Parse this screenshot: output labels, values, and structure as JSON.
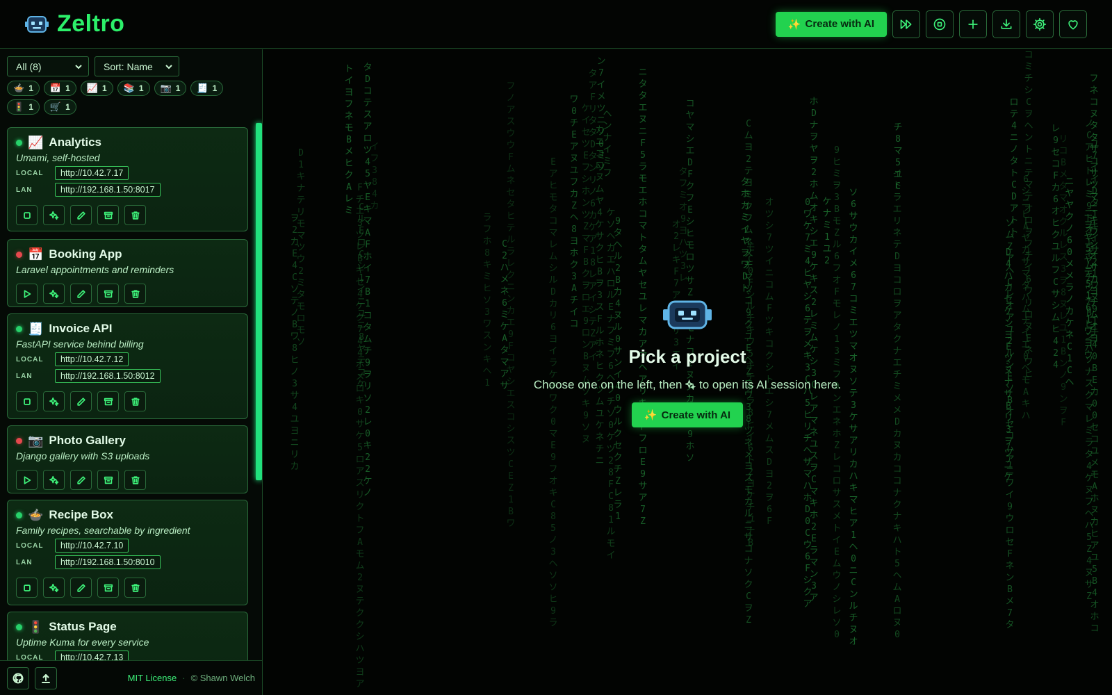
{
  "app": {
    "title": "Zeltro"
  },
  "header": {
    "create_label": "Create with AI",
    "create_spark": "✨",
    "icons": [
      "fast-forward-icon",
      "stop-circle-icon",
      "plus-icon",
      "download-icon",
      "gear-icon",
      "heart-icon"
    ]
  },
  "filters": {
    "category": "All (8)",
    "sort": "Sort: Name"
  },
  "chips": [
    {
      "emoji": "🍲",
      "count": "1"
    },
    {
      "emoji": "📅",
      "count": "1"
    },
    {
      "emoji": "📈",
      "count": "1"
    },
    {
      "emoji": "📚",
      "count": "1"
    },
    {
      "emoji": "📷",
      "count": "1"
    },
    {
      "emoji": "🧾",
      "count": "1"
    },
    {
      "emoji": "🚦",
      "count": "1"
    },
    {
      "emoji": "🛒",
      "count": "1"
    }
  ],
  "url_labels": {
    "local": "LOCAL",
    "lan": "LAN"
  },
  "projects": [
    {
      "name": "Analytics",
      "emoji": "📈",
      "status": "running",
      "desc": "Umami, self-hosted",
      "local": "http://10.42.7.17",
      "lan": "http://192.168.1.50:8017"
    },
    {
      "name": "Booking App",
      "emoji": "📅",
      "status": "stopped",
      "desc": "Laravel appointments and reminders",
      "local": "",
      "lan": ""
    },
    {
      "name": "Invoice API",
      "emoji": "🧾",
      "status": "running",
      "desc": "FastAPI service behind billing",
      "local": "http://10.42.7.12",
      "lan": "http://192.168.1.50:8012"
    },
    {
      "name": "Photo Gallery",
      "emoji": "📷",
      "status": "stopped",
      "desc": "Django gallery with S3 uploads",
      "local": "",
      "lan": ""
    },
    {
      "name": "Recipe Box",
      "emoji": "🍲",
      "status": "running",
      "desc": "Family recipes, searchable by ingredient",
      "local": "http://10.42.7.10",
      "lan": "http://192.168.1.50:8010"
    },
    {
      "name": "Status Page",
      "emoji": "🚦",
      "status": "running",
      "desc": "Uptime Kuma for every service",
      "local": "http://10.42.7.13",
      "lan": ""
    }
  ],
  "footer": {
    "license": "MIT License",
    "separator": "·",
    "copyright": "© Shawn Welch"
  },
  "empty_state": {
    "title": "Pick a project",
    "subtitle_before": "Choose one on the left, then",
    "subtitle_after": "to open its AI session here.",
    "button_label": "Create with AI",
    "button_spark": "✨"
  },
  "colors": {
    "accent": "#22d24f",
    "running": "#27d16a",
    "stopped": "#e5484d",
    "background": "#020402"
  }
}
